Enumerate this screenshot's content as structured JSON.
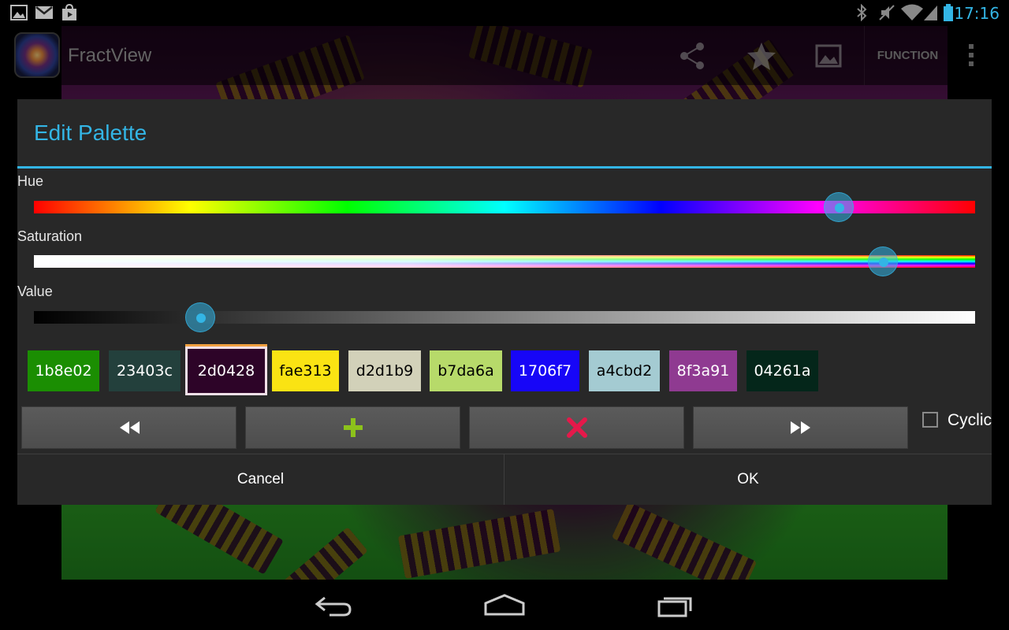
{
  "status_bar": {
    "time": "17:16",
    "left_icons": [
      "image-icon",
      "gmail-icon",
      "play-store-icon"
    ],
    "right_icons": [
      "bluetooth-icon",
      "mute-icon",
      "wifi-icon",
      "signal-icon",
      "battery-icon"
    ],
    "accent": "#33b5e5"
  },
  "action_bar": {
    "title": "FractView",
    "actions": [
      "share-icon",
      "star-icon",
      "image-icon"
    ],
    "function_label": "FUNCTION"
  },
  "dialog": {
    "title": "Edit Palette",
    "accent": "#33b5e5",
    "hue": {
      "label": "Hue",
      "value": 0.855
    },
    "saturation": {
      "label": "Saturation",
      "value": 0.902
    },
    "value": {
      "label": "Value",
      "value": 0.177
    },
    "swatches": [
      {
        "label": "1b8e02",
        "color": "#1b8e02",
        "text": "#ffffff"
      },
      {
        "label": "23403c",
        "color": "#23403c",
        "text": "#ffffff"
      },
      {
        "label": "2d0428",
        "color": "#2d0428",
        "text": "#ffffff",
        "selected": true
      },
      {
        "label": "fae313",
        "color": "#fae313",
        "text": "#000000"
      },
      {
        "label": "d2d1b9",
        "color": "#d2d1b9",
        "text": "#000000"
      },
      {
        "label": "b7da6a",
        "color": "#b7da6a",
        "text": "#000000"
      },
      {
        "label": "1706f7",
        "color": "#1706f7",
        "text": "#ffffff"
      },
      {
        "label": "a4cbd2",
        "color": "#a4cbd2",
        "text": "#000000"
      },
      {
        "label": "8f3a91",
        "color": "#8f3a91",
        "text": "#ffffff"
      },
      {
        "label": "04261a",
        "color": "#04261a",
        "text": "#ffffff"
      }
    ],
    "buttons": [
      "rewind-icon",
      "add-icon",
      "delete-icon",
      "fast-forward-icon"
    ],
    "cyclic": {
      "label": "Cyclic",
      "checked": false
    },
    "cancel_label": "Cancel",
    "ok_label": "OK"
  },
  "nav_bar": [
    "back-icon",
    "home-icon",
    "recent-apps-icon"
  ]
}
